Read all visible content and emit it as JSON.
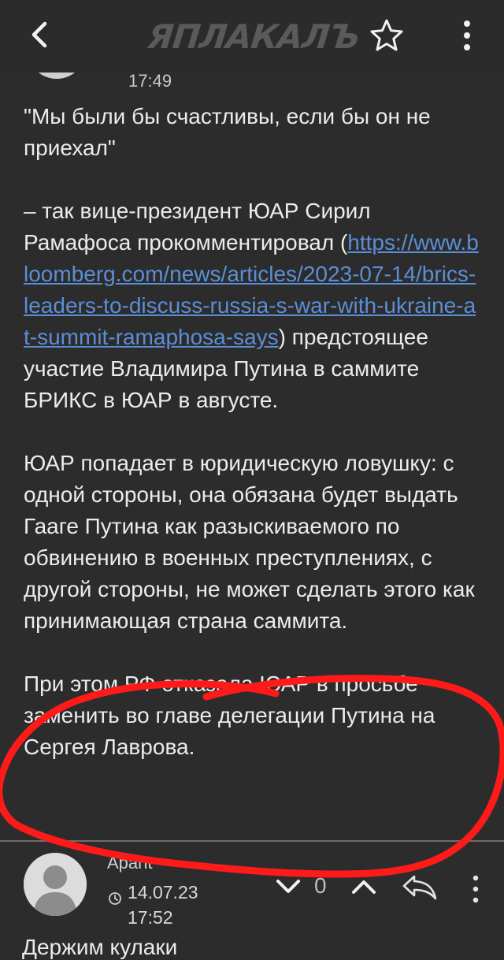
{
  "header": {
    "logo_text": "ЯПЛАКАЛЪ",
    "back_icon": "chevron-left-icon",
    "favorite_icon": "star-outline-icon",
    "menu_icon": "more-vertical-icon"
  },
  "post": {
    "time": "17:49",
    "quote": "\"Мы были бы счастливы, если бы он не приехал\"",
    "p2_prefix": "– так вице-президент ЮАР Сирил Рамафоса прокомментировал (",
    "p2_link": "https://www.bloomberg.com/news/articles/2023-07-14/brics-leaders-to-discuss-russia-s-war-with-ukraine-at-summit-ramaphosa-says",
    "p2_suffix": ") предстоящее участие Владимира Путина в саммите БРИКС в ЮАР в августе.",
    "p3": "ЮАР попадает в юридическую ловушку: с одной стороны, она обязана будет выдать Гааге Путина как разыскиваемого по обвинению в военных преступлениях, с другой стороны, не может сделать этого как принимающая страна саммита.",
    "p4": "При этом РФ отказала ЮАР в просьбе заменить во главе делегации Путина на Сергея Лаврова."
  },
  "comment": {
    "author": "Apant",
    "date": "14.07.23",
    "time": "17:52",
    "rating": "0",
    "text": "Держим кулаки"
  },
  "colors": {
    "background": "#2c2c2c",
    "text": "#ececec",
    "link": "#5b8ed6",
    "annotation": "#ff1a1a"
  }
}
